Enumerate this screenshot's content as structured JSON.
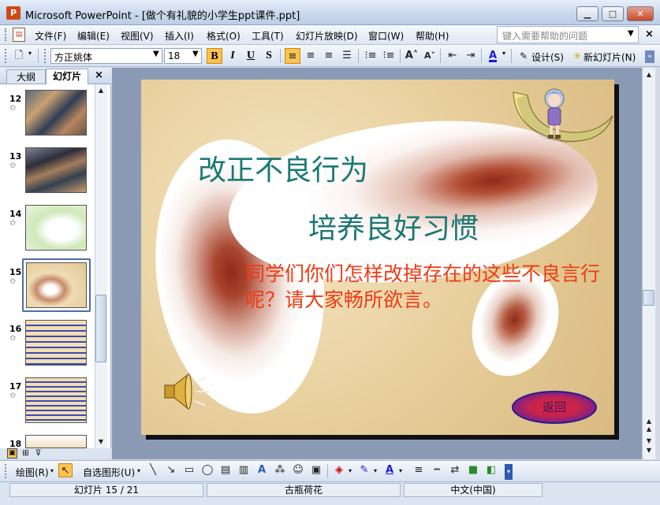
{
  "window": {
    "app_icon": "P",
    "title": "Microsoft PowerPoint - [做个有礼貌的小学生ppt课件.ppt]",
    "minimize": "▁",
    "maximize": "□",
    "close": "✕"
  },
  "menu": {
    "items": [
      "文件(F)",
      "编辑(E)",
      "视图(V)",
      "插入(I)",
      "格式(O)",
      "工具(T)",
      "幻灯片放映(D)",
      "窗口(W)",
      "帮助(H)"
    ],
    "help_placeholder": "键入需要帮助的问题",
    "help_arrow": "▼",
    "close": "×"
  },
  "toolbar": {
    "font_name": "方正姚体",
    "font_size": "18",
    "bold": "B",
    "italic": "I",
    "underline": "U",
    "shadow": "S",
    "design_label": "设计(S)",
    "new_slide_label": "新幻灯片(N)",
    "font_color": "A",
    "font_color_hex": "#1a1ad8",
    "highlight_hex": "#ffc24f"
  },
  "panel": {
    "tab_outline": "大纲",
    "tab_slides": "幻灯片",
    "close": "×",
    "slides": [
      {
        "num": "12",
        "star": "✩"
      },
      {
        "num": "13",
        "star": "✩"
      },
      {
        "num": "14",
        "star": "✩"
      },
      {
        "num": "15",
        "star": "✩"
      },
      {
        "num": "16",
        "star": "✩"
      },
      {
        "num": "17",
        "star": "✩"
      },
      {
        "num": "18",
        "star": "✩"
      }
    ]
  },
  "slide": {
    "title_line1": "改正不良行为",
    "title_line2": "培养良好习惯",
    "body": "同学们你们怎样改掉存在的这些不良言行呢？请大家畅所欲言。",
    "return_button": "返回",
    "title_color": "#1a7875",
    "body_color": "#ee3b14"
  },
  "drawbar": {
    "draw_label": "绘图(R)",
    "autoshape_label": "自选图形(U)"
  },
  "status": {
    "slide_pos": "幻灯片 15 / 21",
    "design": "古瓶荷花",
    "language": "中文(中国)"
  }
}
